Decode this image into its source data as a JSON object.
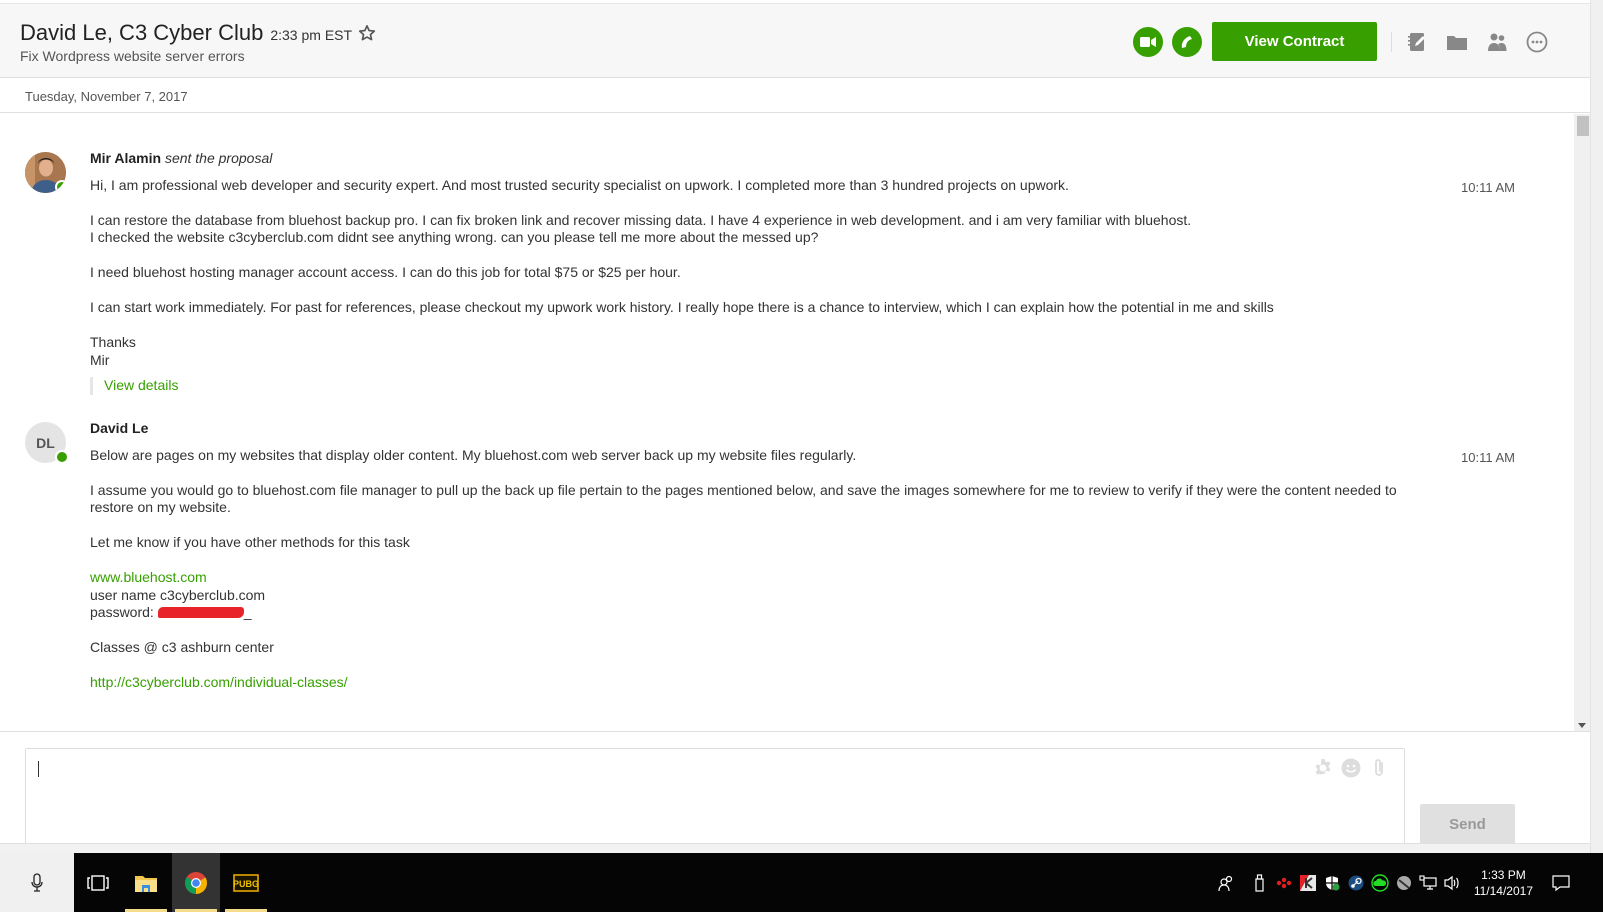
{
  "header": {
    "title": "David Le, C3 Cyber Club",
    "local_time": "2:33 pm EST",
    "subtitle": "Fix Wordpress website server errors",
    "view_contract_label": "View Contract",
    "icons": [
      "video-call-icon",
      "phone-call-icon",
      "notes-icon",
      "folder-icon",
      "people-icon",
      "more-icon"
    ]
  },
  "date_divider": "Tuesday, November 7, 2017",
  "messages": [
    {
      "sender": "Mir Alamin",
      "action": "sent the proposal",
      "time": "10:11 AM",
      "avatar": "photo",
      "online": true,
      "paragraphs": [
        "Hi, I am professional web developer and security expert. And most trusted security specialist on upwork. I completed more than 3 hundred projects on upwork.",
        "I can restore the database from bluehost backup pro. I can fix broken link and recover missing data. I have 4 experience in web development. and i am very familiar with bluehost.\nI checked the website c3cyberclub.com didnt see anything wrong. can you please tell me more about the messed up?",
        "I need bluehost hosting manager account access. I can do this job for total $75 or $25 per hour.",
        "I can start work immediately. For past for references, please checkout my upwork work history. I really hope there is a chance to interview, which I can explain how the potential in me and skills",
        "Thanks\nMir"
      ],
      "details_link": "View details"
    },
    {
      "sender": "David Le",
      "initials": "DL",
      "time": "10:11 AM",
      "online": true,
      "paragraphs": [
        "Below are pages on my websites that display older content. My bluehost.com web server back up my website files regularly.",
        "I assume you would go to bluehost.com file manager to pull up the back up file pertain to the pages mentioned below, and save the images somewhere for me to review to verify if they were the content needed to restore on my website.",
        "Let me know if you have other methods for this task"
      ],
      "link1": "www.bluehost.com",
      "username_line": "user name c3cyberclub.com",
      "password_label": "password:",
      "password_suffix": "_",
      "classes_line": "Classes @ c3 ashburn center",
      "link2": "http://c3cyberclub.com/individual-classes/"
    }
  ],
  "composer": {
    "value": "",
    "send_label": "Send",
    "tools": [
      "gear-icon",
      "emoji-icon",
      "paperclip-icon"
    ]
  },
  "taskbar": {
    "pinned": [
      "task-view",
      "file-explorer",
      "chrome",
      "pubg"
    ],
    "active": "chrome",
    "clock_time": "1:33 PM",
    "clock_date": "11/14/2017"
  },
  "colors": {
    "accent": "#37a000",
    "send_disabled": "#e0e0e0",
    "redaction": "#e8232a"
  }
}
